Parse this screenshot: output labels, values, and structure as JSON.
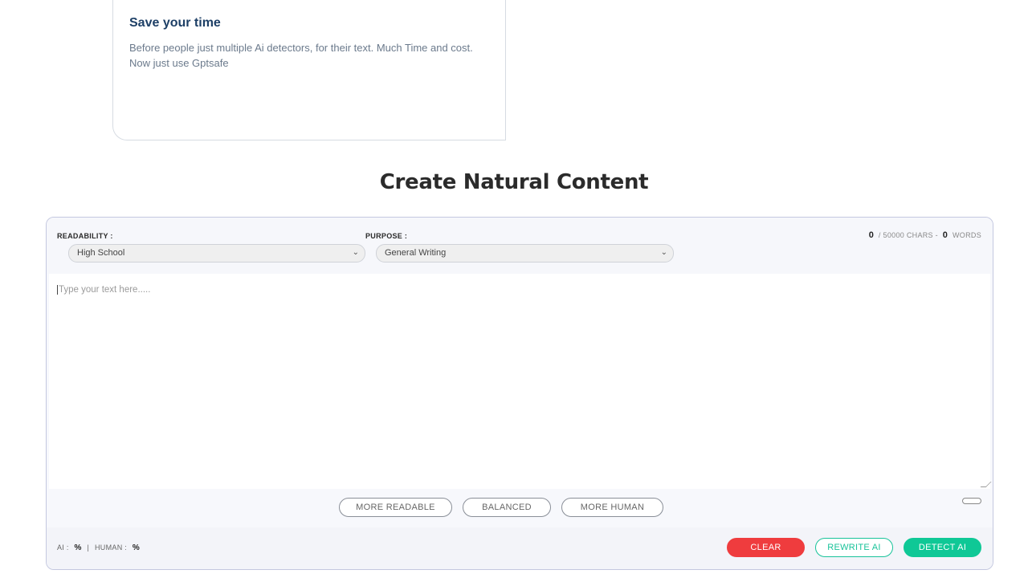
{
  "feature": {
    "title": "Save your time",
    "description": "Before people just multiple Ai detectors, for their text. Much Time and cost. Now just use Gptsafe"
  },
  "section": {
    "title": "Create Natural Content"
  },
  "controls": {
    "readability_label": "READABILITY :",
    "readability_value": "High School",
    "purpose_label": "PURPOSE :",
    "purpose_value": "General Writing"
  },
  "counter": {
    "chars": "0",
    "chars_suffix": "/ 50000 CHARS -",
    "words": "0",
    "words_suffix": "WORDS"
  },
  "editor": {
    "placeholder": "Type your text here....."
  },
  "modes": [
    "MORE READABLE",
    "BALANCED",
    "MORE HUMAN"
  ],
  "stats": {
    "ai_label": "AI :",
    "ai_value": "%",
    "separator": "|",
    "human_label": "HUMAN :",
    "human_value": "%"
  },
  "actions": {
    "clear": "CLEAR",
    "rewrite": "REWRITE AI",
    "detect": "DETECT AI"
  },
  "icons": {
    "select_chevron": "chevron-down-icon"
  },
  "colors": {
    "title_blue": "#1d3f66",
    "clear_red": "#ef3c3e",
    "accent_green": "#0fc896"
  }
}
